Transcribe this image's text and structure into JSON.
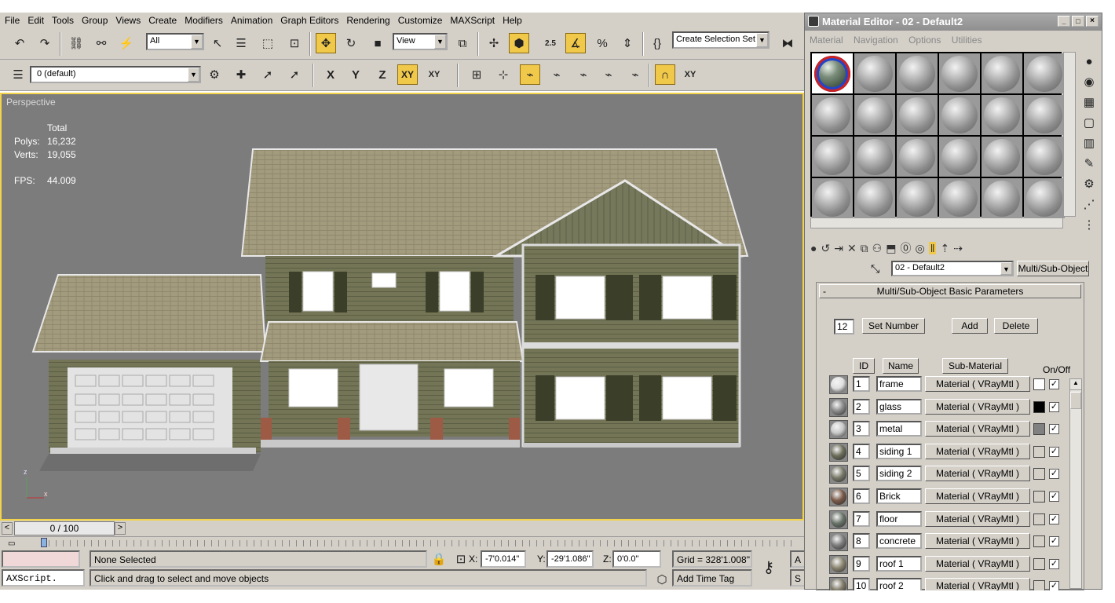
{
  "menu": [
    "File",
    "Edit",
    "Tools",
    "Group",
    "Views",
    "Create",
    "Modifiers",
    "Animation",
    "Graph Editors",
    "Rendering",
    "Customize",
    "MAXScript",
    "Help"
  ],
  "toolbar": {
    "selection_filter": "All",
    "ref_coord": "View",
    "angle_snap": "2.5",
    "named_selection": "Create Selection Set",
    "layer": "0 (default)",
    "axis_x": "X",
    "axis_y": "Y",
    "axis_z": "Z",
    "axis_xy": "XY",
    "axis_xy2": "XY"
  },
  "viewport": {
    "label": "Perspective",
    "stats_header": "Total",
    "polys_label": "Polys:",
    "polys": "16,232",
    "verts_label": "Verts:",
    "verts": "19,055",
    "fps_label": "FPS:",
    "fps": "44.009",
    "axis_z": "z",
    "axis_x": "x"
  },
  "timeline": {
    "frame": "0 / 100",
    "prev": "<",
    "next": ">"
  },
  "status": {
    "maxscript": "AXScript.",
    "selection": "None Selected",
    "prompt": "Click and drag to select and move objects",
    "x_label": "X:",
    "x": "-7'0.014\"",
    "y_label": "Y:",
    "y": "-29'1.086\"",
    "z_label": "Z:",
    "z": "0'0.0\"",
    "grid": "Grid = 328'1.008\"",
    "add_time_tag": "Add Time Tag",
    "cut1": "A",
    "cut2": "S"
  },
  "material_editor": {
    "title": "Material Editor - 02 - Default2",
    "menu": [
      "Material",
      "Navigation",
      "Options",
      "Utilities"
    ],
    "material_name": "02 - Default2",
    "type_button": "Multi/Sub-Object",
    "rollout_title": "Multi/Sub-Object Basic Parameters",
    "rollout_toggle": "-",
    "count": "12",
    "set_number": "Set Number",
    "add": "Add",
    "delete": "Delete",
    "col_id": "ID",
    "col_name": "Name",
    "col_sub": "Sub-Material",
    "col_onoff": "On/Off",
    "rows": [
      {
        "id": "1",
        "name": "frame",
        "sub": "Material ( VRayMtl )",
        "color": "#ffffff",
        "ball": "#e0e0e0"
      },
      {
        "id": "2",
        "name": "glass",
        "sub": "Material ( VRayMtl )",
        "color": "#000000",
        "ball": "#8a8a8a"
      },
      {
        "id": "3",
        "name": "metal",
        "sub": "Material ( VRayMtl )",
        "color": "#808080",
        "ball": "#c8c8c8"
      },
      {
        "id": "4",
        "name": "siding 1",
        "sub": "Material ( VRayMtl )",
        "color": "#d4d0c8",
        "ball": "#6d6d5a"
      },
      {
        "id": "5",
        "name": "siding 2",
        "sub": "Material ( VRayMtl )",
        "color": "#d4d0c8",
        "ball": "#7a7a6a"
      },
      {
        "id": "6",
        "name": "Brick",
        "sub": "Material ( VRayMtl )",
        "color": "#d4d0c8",
        "ball": "#7a5a48"
      },
      {
        "id": "7",
        "name": "floor",
        "sub": "Material ( VRayMtl )",
        "color": "#d4d0c8",
        "ball": "#6a756a"
      },
      {
        "id": "8",
        "name": "concrete",
        "sub": "Material ( VRayMtl )",
        "color": "#d4d0c8",
        "ball": "#7d7d7d"
      },
      {
        "id": "9",
        "name": "roof 1",
        "sub": "Material ( VRayMtl )",
        "color": "#d4d0c8",
        "ball": "#8a8470"
      },
      {
        "id": "10",
        "name": "roof 2",
        "sub": "Material ( VRayMtl )",
        "color": "#d4d0c8",
        "ball": "#7f7a68"
      }
    ],
    "colors": {
      "accent": "#f1c94a",
      "viewport_bg": "#7c7c7c",
      "ui_gray": "#d4d0c8"
    }
  }
}
